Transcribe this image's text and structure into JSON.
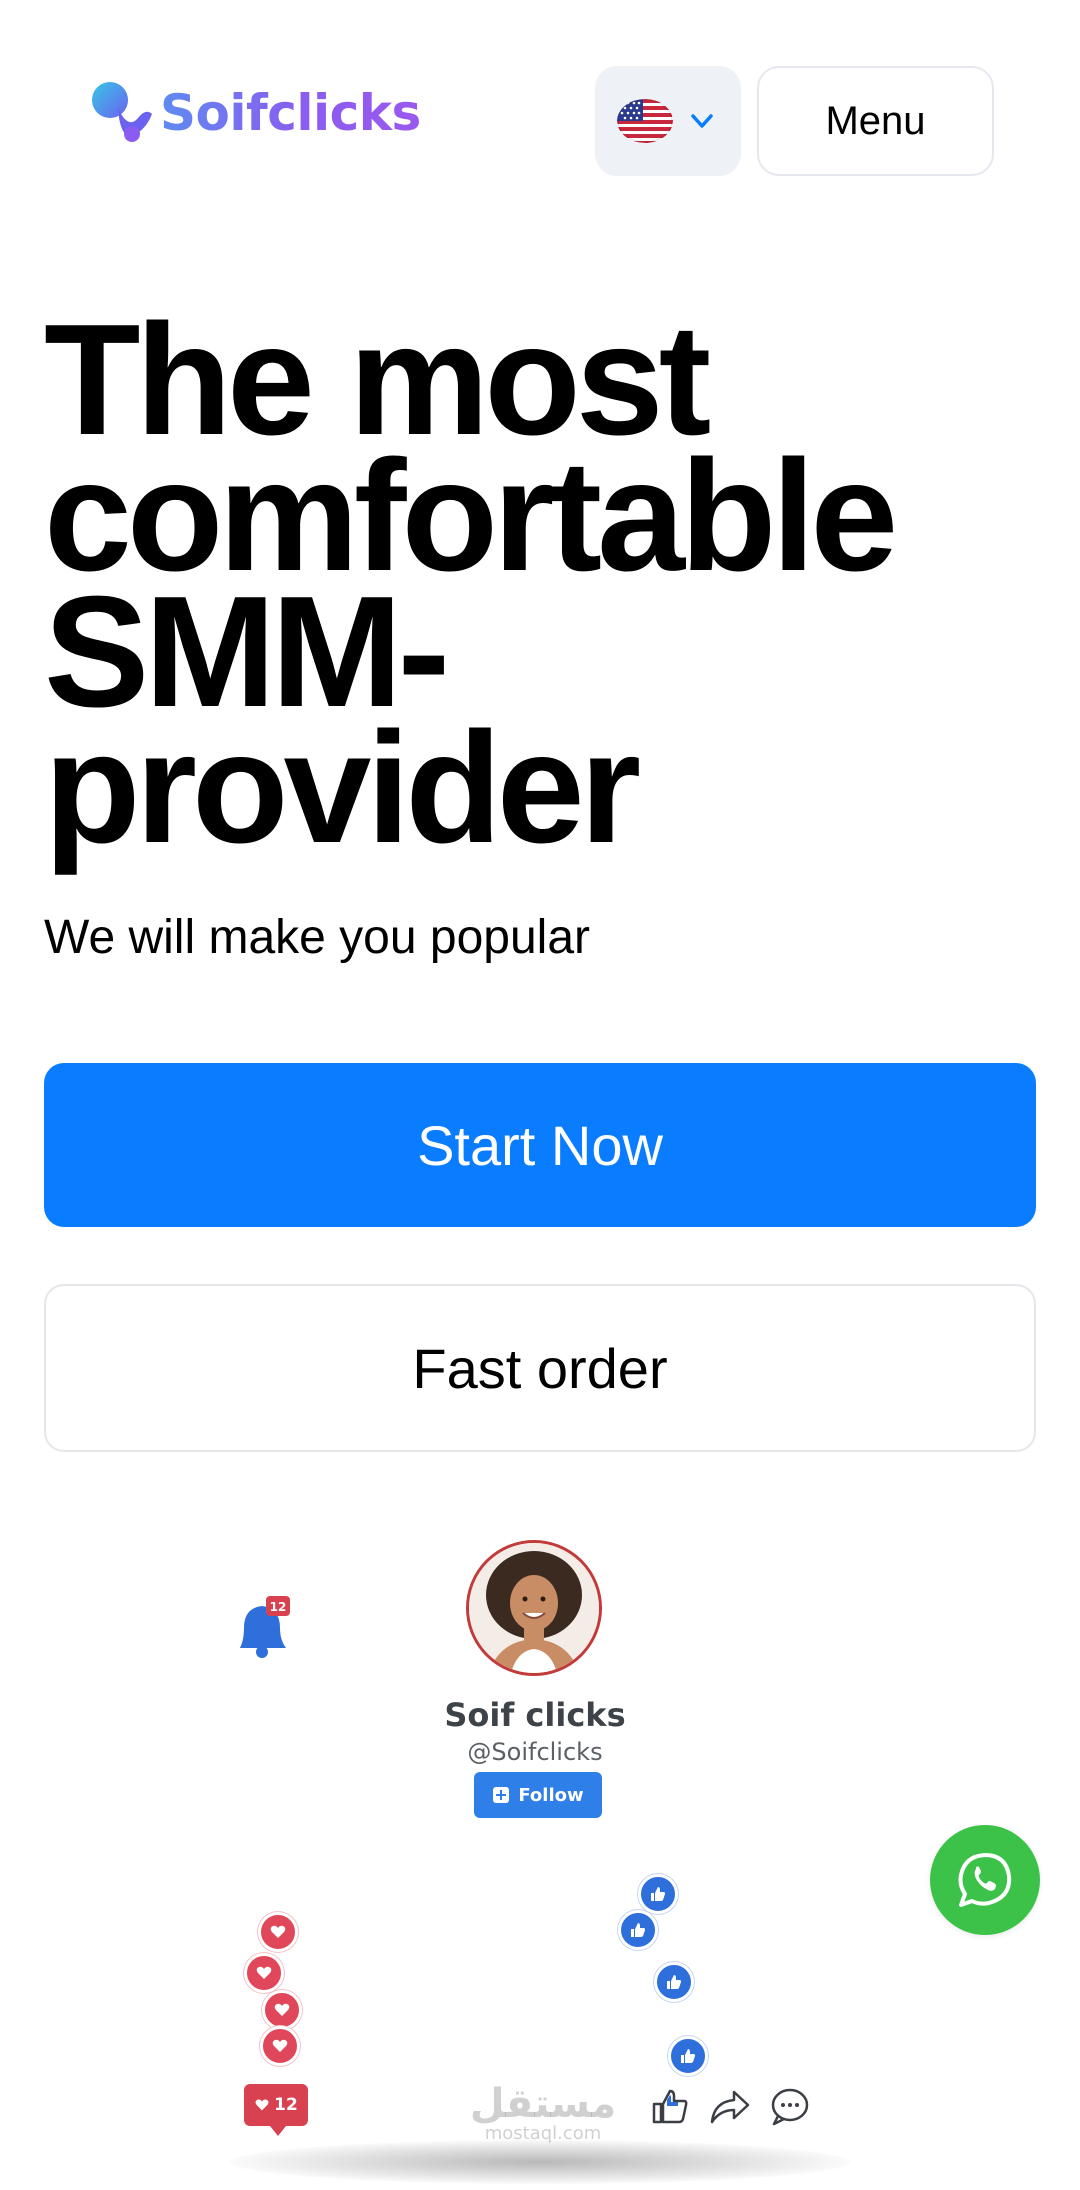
{
  "header": {
    "brand": "Soifclicks",
    "language": {
      "icon": "us-flag-icon",
      "chevron_icon": "chevron-down-icon"
    },
    "menu_label": "Menu"
  },
  "hero": {
    "title_lines": [
      "The most",
      "comfortable",
      "SMM-",
      "provider"
    ],
    "subtitle": "We will make you popular",
    "primary_cta": "Start Now",
    "secondary_cta": "Fast order"
  },
  "profile_card": {
    "name": "Soif clicks",
    "handle": "@Soifclicks",
    "follow_label": "Follow",
    "notification_count": "12",
    "heart_count": "12"
  },
  "watermark": {
    "arabic": "مستقل",
    "latin": "mostaql.com"
  },
  "colors": {
    "primary": "#0a7cff",
    "whatsapp": "#3cc248",
    "heart": "#e0475a",
    "like": "#2e6fdc",
    "brand_gradient_start": "#5f8bf0",
    "brand_gradient_end": "#9b59ee"
  },
  "icons": {
    "whatsapp": "whatsapp-icon",
    "bell": "bell-icon",
    "heart": "heart-icon",
    "like": "thumbs-up-icon",
    "share": "share-icon",
    "comment": "comment-icon"
  }
}
